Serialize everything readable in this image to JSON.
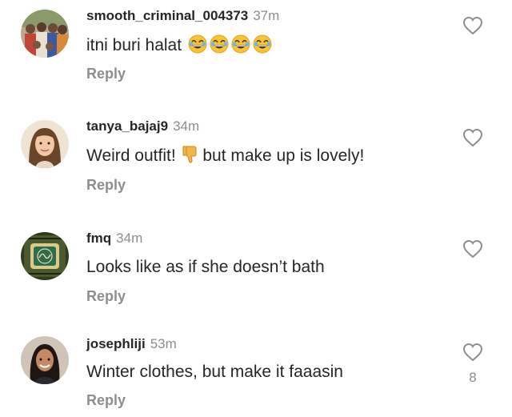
{
  "comments": [
    {
      "username": "smooth_criminal_004373",
      "time": "37m",
      "text": "itni buri halat",
      "emoji": "😂😂😂😂",
      "reply": "Reply",
      "like_icon": "heart-outline-icon",
      "avatar": "group-photo-avatar"
    },
    {
      "username": "tanya_bajaj9",
      "time": "34m",
      "text_before": "Weird outfit!",
      "emoji": "👎",
      "text_after": "but make up is lovely!",
      "reply": "Reply",
      "like_icon": "heart-outline-icon",
      "avatar": "woman-portrait-avatar"
    },
    {
      "username": "fmq",
      "time": "34m",
      "text": "Looks like as if she doesn’t bath",
      "reply": "Reply",
      "like_icon": "heart-outline-icon",
      "avatar": "calligraphy-emblem-avatar"
    },
    {
      "username": "josephliji",
      "time": "53m",
      "text": "Winter clothes, but make it faaasin",
      "reply": "Reply",
      "like_icon": "heart-outline-icon",
      "like_count": "8",
      "avatar": "woman-portrait-avatar"
    }
  ],
  "colors": {
    "text": "#262626",
    "secondary": "#8e8e8e",
    "background": "#ffffff"
  }
}
